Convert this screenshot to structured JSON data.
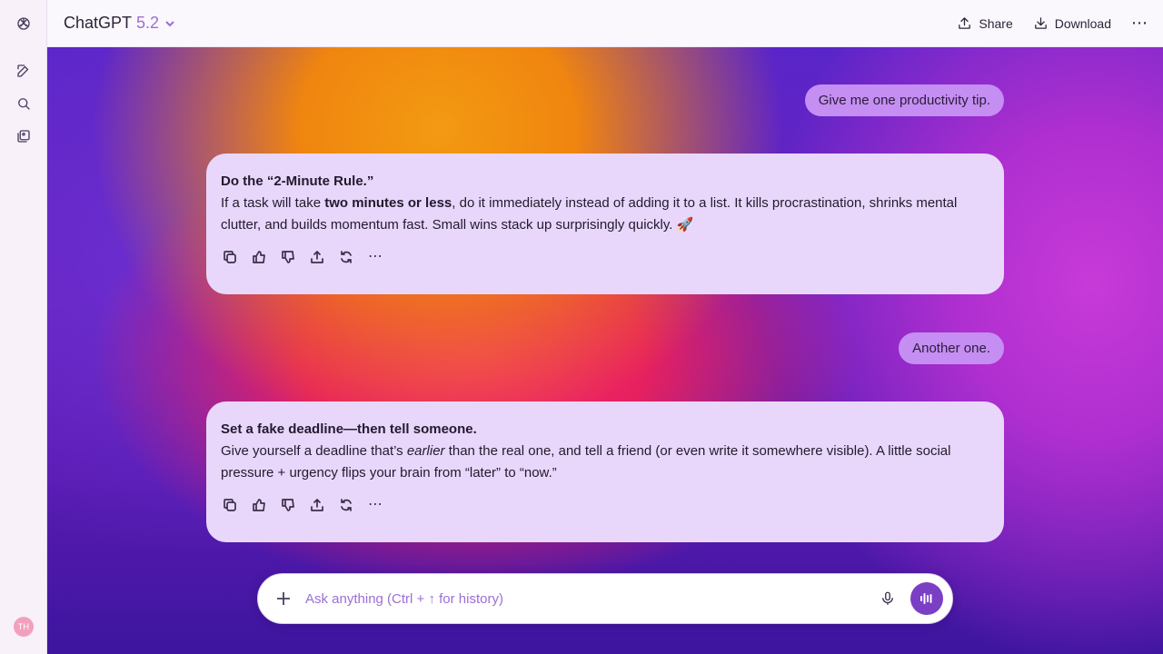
{
  "header": {
    "model_name": "ChatGPT",
    "model_version": "5.2",
    "share_label": "Share",
    "download_label": "Download"
  },
  "sidebar": {
    "avatar_initials": "TH"
  },
  "messages": {
    "user1": "Give me one productivity tip.",
    "ai1": {
      "title": "Do the “2-Minute Rule.”",
      "line_prefix": "If a task will take ",
      "bold": "two minutes or less",
      "line_suffix": ", do it immediately instead of adding it to a list. It kills procrastination, shrinks mental clutter, and builds momentum fast. Small wins stack up surprisingly quickly. 🚀"
    },
    "user2": "Another one.",
    "ai2": {
      "title": "Set a fake deadline—then tell someone.",
      "line_prefix": "Give yourself a deadline that’s ",
      "italic": "earlier",
      "line_suffix": " than the real one, and tell a friend (or even write it somewhere visible). A little social pressure + urgency flips your brain from “later” to “now.”"
    }
  },
  "composer": {
    "placeholder": "Ask anything (Ctrl + ↑ for history)"
  },
  "icons": {
    "logo": "openai-logo-icon",
    "new_chat": "edit-icon",
    "search": "search-icon",
    "library": "images-icon",
    "share": "upload-icon",
    "download": "download-icon",
    "mic": "microphone-icon",
    "voice": "waveform-icon"
  },
  "colors": {
    "accent": "#9b6fd6",
    "user_bubble": "#c58ef2",
    "ai_bubble": "#e8d7fb",
    "voice_button": "#7b3fc5"
  }
}
